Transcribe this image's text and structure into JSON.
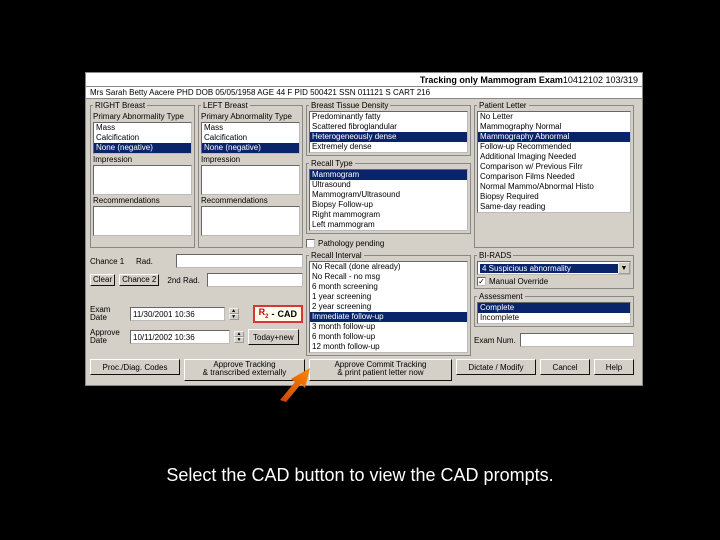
{
  "title": "Tracking only Mammogram Exam",
  "title_numbers": "10412102  103/319",
  "infobar": "Mrs  Sarah Betty Aacere  PHD    DOB  05/05/1958   AGE  44   F   PID  500421   SSN  011121   S  CART  216",
  "right_breast": {
    "legend": "RIGHT Breast",
    "primary": "Primary Abnormality Type",
    "items": [
      "Mass",
      "Calcification",
      "None (negative)"
    ],
    "selected": 2,
    "impression": "Impression",
    "recs": "Recommendations"
  },
  "left_breast": {
    "legend": "LEFT Breast",
    "primary": "Primary Abnormality Type",
    "items": [
      "Mass",
      "Calcification",
      "None (negative)"
    ],
    "selected": 2,
    "impression": "Impression",
    "recs": "Recommendations"
  },
  "density": {
    "legend": "Breast Tissue Density",
    "items": [
      "Predominantly fatty",
      "Scattered fibroglandular",
      "Heterogeneously dense",
      "Extremely dense"
    ],
    "selected": 2
  },
  "recall": {
    "legend": "Recall Type",
    "items": [
      "Mammogram",
      "Ultrasound",
      "Mammogram/Ultrasound",
      "Biopsy Follow-up",
      "Right mammogram",
      "Left mammogram"
    ],
    "selected": 0
  },
  "pathology_pending": "Pathology pending",
  "recall_interval": {
    "legend": "Recall Interval",
    "items": [
      "No Recall (done already)",
      "No Recall - no msg",
      "6 month screening",
      "1 year screening",
      "2 year screening",
      "Immediate follow-up",
      "3 month follow-up",
      "6 month follow-up",
      "12 month follow-up"
    ],
    "selected": 5
  },
  "letter": {
    "legend": "Patient Letter",
    "items": [
      "No Letter",
      "Mammography Normal",
      "Mammography Abnormal",
      "Follow-up Recommended",
      "Additional Imaging Needed",
      "Comparison w/ Previous Filrr",
      "Comparison Films Needed",
      "Normal Mammo/Abnormal Histo",
      "Biopsy Required",
      "Same-day reading"
    ],
    "selected": 2
  },
  "birads": {
    "legend": "BI-RADS",
    "value": "4 Suspicious abnormality",
    "manual": "Manual Override",
    "manual_checked": true
  },
  "assessment": {
    "legend": "Assessment",
    "items": [
      "Complete",
      "Incomplete"
    ],
    "selected": 0
  },
  "chance": {
    "label1": "Chance 1",
    "label2": "2nd Rad."
  },
  "rad_label": "Rad.",
  "clear": "Clear",
  "chance2": "Chance 2",
  "exam_date": {
    "label": "Exam\nDate",
    "value": "11/30/2001  10:36"
  },
  "approve_date": {
    "label": "Approve\nDate",
    "value": "10/11/2002 10:36"
  },
  "today_new": "Today+new",
  "cad": "CAD",
  "r2": "R",
  "exam_num": "Exam Num.",
  "buttons": {
    "proc": "Proc./Diag. Codes",
    "approve1": "Approve Tracking\n& transcribed externally",
    "approve2": "Approve Commit Tracking\n& print patient letter now",
    "dictate": "Dictate / Modify",
    "cancel": "Cancel",
    "help": "Help"
  },
  "caption": "Select the CAD button to view the CAD prompts."
}
